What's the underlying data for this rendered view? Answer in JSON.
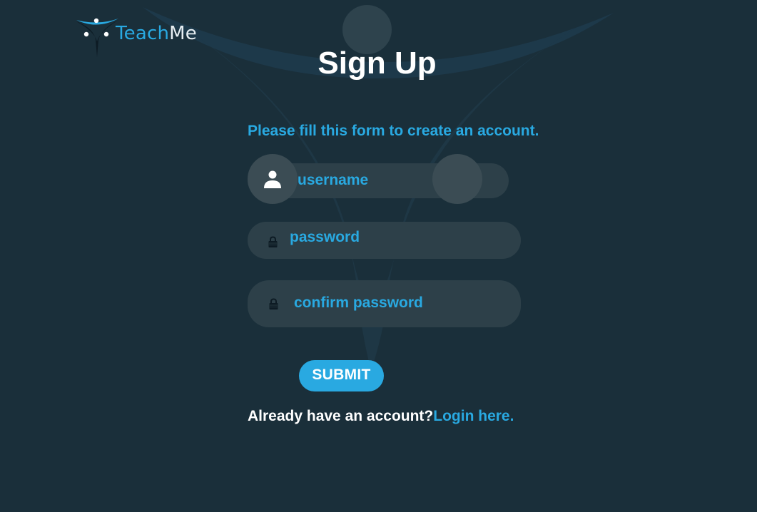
{
  "brand": {
    "name_part1": "Teach",
    "name_part2": "Me",
    "accent_color": "#29a9e1",
    "background_color": "#1a2f3a"
  },
  "page": {
    "title": "Sign Up",
    "subtitle": "Please fill this form to create an account."
  },
  "form": {
    "username": {
      "placeholder": "username",
      "icon": "user-icon"
    },
    "password": {
      "placeholder": "password",
      "icon": "lock-icon"
    },
    "confirm_password": {
      "placeholder": "confirm password",
      "icon": "lock-icon"
    },
    "submit_label": "SUBMIT"
  },
  "footer": {
    "question": "Already have an account?",
    "login_link": "Login here."
  }
}
